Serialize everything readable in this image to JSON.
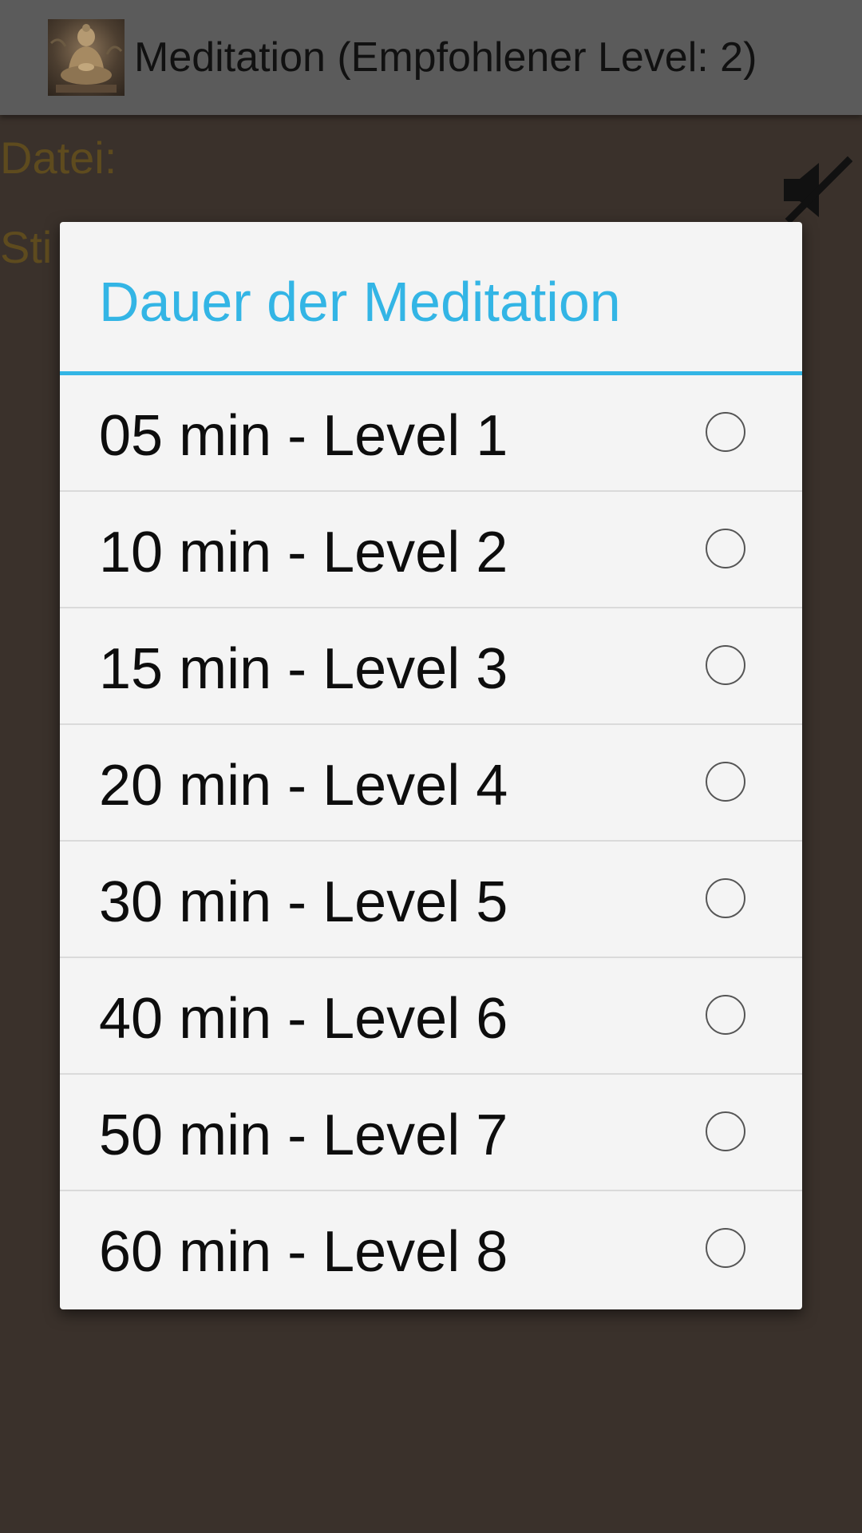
{
  "action_bar": {
    "icon": "buddha-statue-icon",
    "title": "Meditation (Empfohlener Level: 2)"
  },
  "background": {
    "file_label": "Datei:",
    "voice_label": "Sti",
    "mute_icon": "speaker-muted-icon"
  },
  "dialog": {
    "title": "Dauer der Meditation",
    "accent_color": "#33b5e5",
    "options": [
      {
        "label": "05 min - Level 1",
        "selected": false
      },
      {
        "label": "10 min - Level 2",
        "selected": false
      },
      {
        "label": "15 min - Level 3",
        "selected": false
      },
      {
        "label": "20 min - Level 4",
        "selected": false
      },
      {
        "label": "30 min - Level 5",
        "selected": false
      },
      {
        "label": "40 min - Level 6",
        "selected": false
      },
      {
        "label": "50 min - Level 7",
        "selected": false
      },
      {
        "label": "60 min - Level 8",
        "selected": false
      }
    ]
  }
}
